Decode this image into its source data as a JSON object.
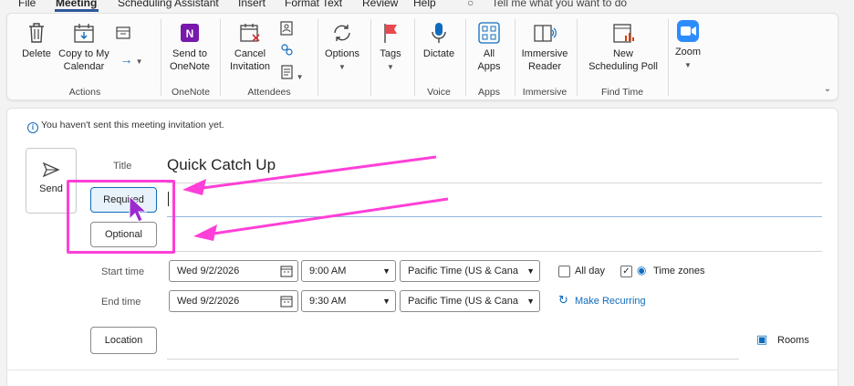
{
  "menu": {
    "items": [
      "File",
      "Meeting",
      "Scheduling Assistant",
      "Insert",
      "Format Text",
      "Review",
      "Help"
    ],
    "tell_me": "Tell me what you want to do"
  },
  "ribbon": {
    "delete": "Delete",
    "copy_calendar": [
      "Copy to My",
      "Calendar"
    ],
    "actions_group": "Actions",
    "send_onenote": [
      "Send to",
      "OneNote"
    ],
    "onenote_group": "OneNote",
    "cancel_invitation": [
      "Cancel",
      "Invitation"
    ],
    "attendees_group": "Attendees",
    "options": "Options",
    "tags": "Tags",
    "dictate": "Dictate",
    "voice_group": "Voice",
    "all_apps": [
      "All",
      "Apps"
    ],
    "apps_group": "Apps",
    "immersive_reader": [
      "Immersive",
      "Reader"
    ],
    "immersive_group": "Immersive",
    "new_poll": [
      "New",
      "Scheduling Poll"
    ],
    "find_time_group": "Find Time",
    "zoom": "Zoom"
  },
  "form": {
    "info": "You haven't sent this meeting invitation yet.",
    "send": "Send",
    "title_label": "Title",
    "title_value": "Quick Catch Up",
    "required": "Required",
    "optional": "Optional",
    "start_label": "Start time",
    "end_label": "End time",
    "start_date": "Wed 9/2/2026",
    "start_time": "9:00 AM",
    "end_date": "Wed 9/2/2026",
    "end_time": "9:30 AM",
    "timezone": "Pacific Time (US & Cana",
    "all_day": "All day",
    "time_zones": "Time zones",
    "make_recurring": "Make Recurring",
    "location": "Location",
    "rooms": "Rooms"
  },
  "colors": {
    "annotation": "#ff3fd7",
    "accent": "#0f6cbd",
    "onenote": "#7719aa",
    "zoom": "#2d8cff"
  }
}
